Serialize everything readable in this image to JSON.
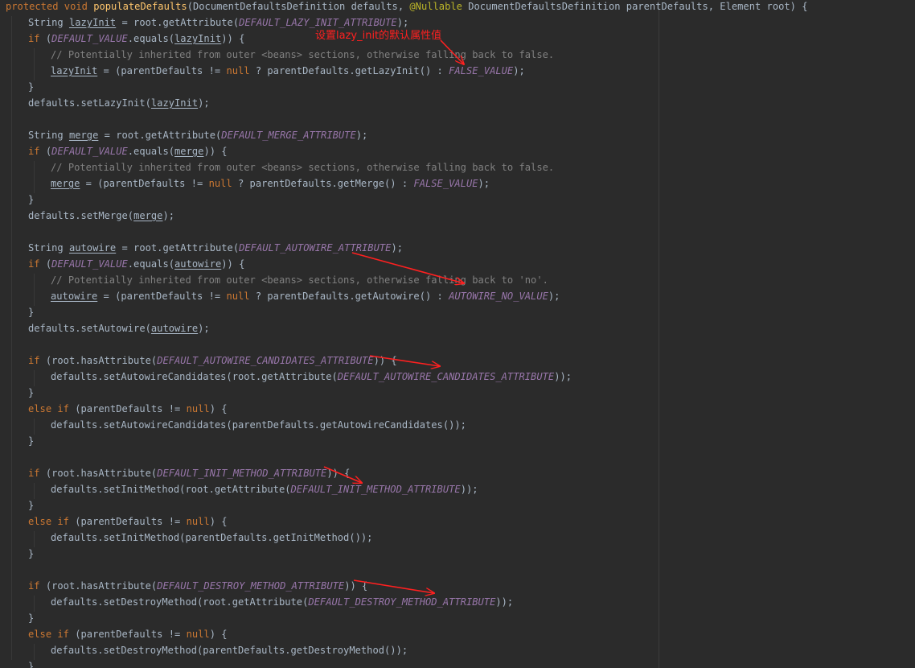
{
  "code": {
    "lines": [
      [
        "protected void populateDefaults(DocumentDefaultsDefinition defaults, @Nullable DocumentDefaultsDefinition parentDefaults, Element root) {"
      ],
      [
        "String lazyInit = root.getAttribute(DEFAULT_LAZY_INIT_ATTRIBUTE);"
      ],
      [
        "if (DEFAULT_VALUE.equals(lazyInit)) {"
      ],
      [
        "// Potentially inherited from outer <beans> sections, otherwise falling back to false."
      ],
      [
        "lazyInit = (parentDefaults != null ? parentDefaults.getLazyInit() : FALSE_VALUE);"
      ],
      [
        "}"
      ],
      [
        "defaults.setLazyInit(lazyInit);"
      ],
      [
        ""
      ],
      [
        "String merge = root.getAttribute(DEFAULT_MERGE_ATTRIBUTE);"
      ],
      [
        "if (DEFAULT_VALUE.equals(merge)) {"
      ],
      [
        "// Potentially inherited from outer <beans> sections, otherwise falling back to false."
      ],
      [
        "merge = (parentDefaults != null ? parentDefaults.getMerge() : FALSE_VALUE);"
      ],
      [
        "}"
      ],
      [
        "defaults.setMerge(merge);"
      ],
      [
        ""
      ],
      [
        "String autowire = root.getAttribute(DEFAULT_AUTOWIRE_ATTRIBUTE);"
      ],
      [
        "if (DEFAULT_VALUE.equals(autowire)) {"
      ],
      [
        "// Potentially inherited from outer <beans> sections, otherwise falling back to 'no'."
      ],
      [
        "autowire = (parentDefaults != null ? parentDefaults.getAutowire() : AUTOWIRE_NO_VALUE);"
      ],
      [
        "}"
      ],
      [
        "defaults.setAutowire(autowire);"
      ],
      [
        ""
      ],
      [
        "if (root.hasAttribute(DEFAULT_AUTOWIRE_CANDIDATES_ATTRIBUTE)) {"
      ],
      [
        "defaults.setAutowireCandidates(root.getAttribute(DEFAULT_AUTOWIRE_CANDIDATES_ATTRIBUTE));"
      ],
      [
        "}"
      ],
      [
        "else if (parentDefaults != null) {"
      ],
      [
        "defaults.setAutowireCandidates(parentDefaults.getAutowireCandidates());"
      ],
      [
        "}"
      ],
      [
        ""
      ],
      [
        "if (root.hasAttribute(DEFAULT_INIT_METHOD_ATTRIBUTE)) {"
      ],
      [
        "defaults.setInitMethod(root.getAttribute(DEFAULT_INIT_METHOD_ATTRIBUTE));"
      ],
      [
        "}"
      ],
      [
        "else if (parentDefaults != null) {"
      ],
      [
        "defaults.setInitMethod(parentDefaults.getInitMethod());"
      ],
      [
        "}"
      ],
      [
        ""
      ],
      [
        "if (root.hasAttribute(DEFAULT_DESTROY_METHOD_ATTRIBUTE)) {"
      ],
      [
        "defaults.setDestroyMethod(root.getAttribute(DEFAULT_DESTROY_METHOD_ATTRIBUTE));"
      ],
      [
        "}"
      ],
      [
        "else if (parentDefaults != null) {"
      ],
      [
        "defaults.setDestroyMethod(parentDefaults.getDestroyMethod());"
      ],
      [
        "}"
      ]
    ]
  },
  "annotation": {
    "note": "设置lazy_init的默认属性值",
    "color": "#ff2020",
    "arrow_icon": "red-arrow-icon"
  },
  "theme": {
    "background": "#2b2b2b",
    "keyword": "#cc7832",
    "method": "#ffc66d",
    "constant": "#9876aa",
    "comment": "#808080",
    "annotation": "#bbb529",
    "text": "#a9b7c6"
  }
}
